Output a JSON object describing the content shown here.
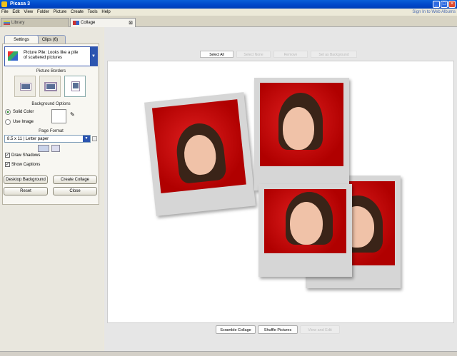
{
  "window": {
    "title": "Picasa 3"
  },
  "menu": [
    "File",
    "Edit",
    "View",
    "Folder",
    "Picture",
    "Create",
    "Tools",
    "Help"
  ],
  "signin": "Sign In to Web Albums",
  "tabs": {
    "library": "Library",
    "collage": "Collage"
  },
  "panel": {
    "tab_settings": "Settings",
    "tab_clips": "Clips (6)",
    "style_text": "Picture Pile:  Looks like a pile of scattered pictures",
    "picture_borders": "Picture Borders",
    "background_options": "Background Options",
    "solid_color": "Solid Color",
    "use_image": "Use Image",
    "page_format": "Page Format",
    "format_value": "8.5 x 11 | Letter paper",
    "draw_shadows": "Draw Shadows",
    "show_captions": "Show Captions",
    "desktop_background": "Desktop Background",
    "create_collage": "Create Collage",
    "reset": "Reset",
    "close": "Close"
  },
  "canvas_toolbar": {
    "select_all": "Select All",
    "select_none": "Select None",
    "remove": "Remove",
    "set_background": "Set as Background"
  },
  "bottom_toolbar": {
    "scramble": "Scramble Collage",
    "shuffle": "Shuffle Pictures",
    "view_edit": "View and Edit"
  },
  "colors": {
    "accent": "#0046c8",
    "photo_bg": "#cc0000",
    "border": "#d6d6d6"
  },
  "options": {
    "solid_color_selected": true,
    "draw_shadows": true,
    "show_captions": true
  }
}
